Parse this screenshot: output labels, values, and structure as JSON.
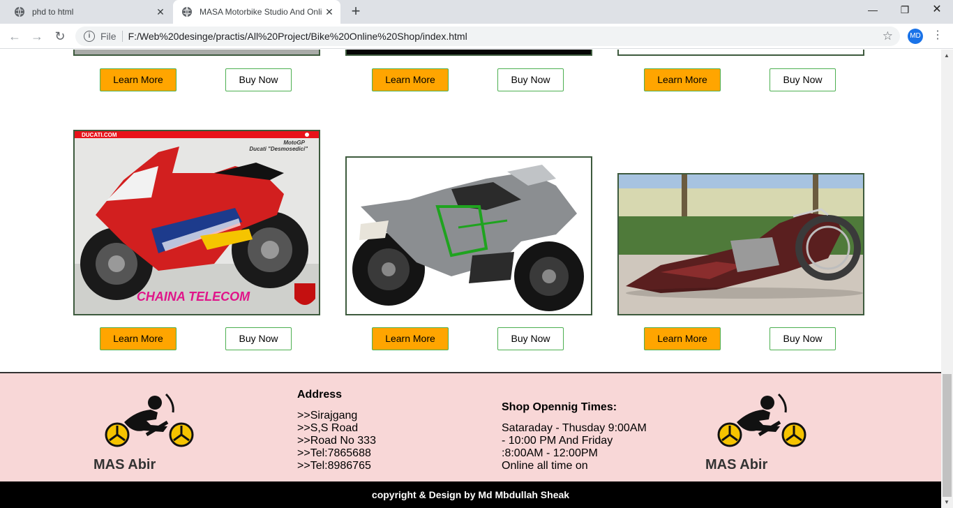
{
  "browser": {
    "tabs": [
      {
        "title": "phd to html",
        "active": false
      },
      {
        "title": "MASA Motorbike Studio And Online Shop",
        "active": true
      }
    ],
    "new_tab_symbol": "+",
    "url_scheme_label": "File",
    "url": "F:/Web%20desinge/practis/All%20Project/Bike%20Online%20Shop/index.html",
    "profile_initials": "MD",
    "window_controls": {
      "minimize": "—",
      "maximize": "❐",
      "close": "✕"
    }
  },
  "products": {
    "learn_label": "Learn More",
    "buy_label": "Buy Now",
    "items": [
      {
        "image": "Ducati MotoGP sportbike - red",
        "image_texts": [
          "DUCATI.COM",
          "MotoGP",
          "Ducati \"Desmosedici\"",
          "CHAINA TELECOM"
        ]
      },
      {
        "image": "Kawasaki Ninja H2 - silver/black",
        "image_texts": []
      },
      {
        "image": "Custom chopper motorbike - maroon",
        "image_texts": []
      }
    ]
  },
  "footer": {
    "brand_name": "MAS Abir",
    "address_title": "Address",
    "address_lines": [
      ">>Sirajgang",
      ">>S,S Road",
      ">>Road No 333",
      ">>Tel:7865688",
      ">>Tel:8986765"
    ],
    "hours_title": "Shop Opennig Times:",
    "hours_lines": [
      "Sataraday - Thusday 9:00AM",
      "- 10:00 PM And Friday",
      ":8:00AM - 12:00PM",
      "Online all time on"
    ],
    "copyright": "copyright & Design by Md Mbdullah Sheak"
  },
  "colors": {
    "learn_button_bg": "#ffa500",
    "button_border": "#4caf50",
    "footer_bg": "#f8d7d7",
    "copyright_bg": "#000000"
  }
}
